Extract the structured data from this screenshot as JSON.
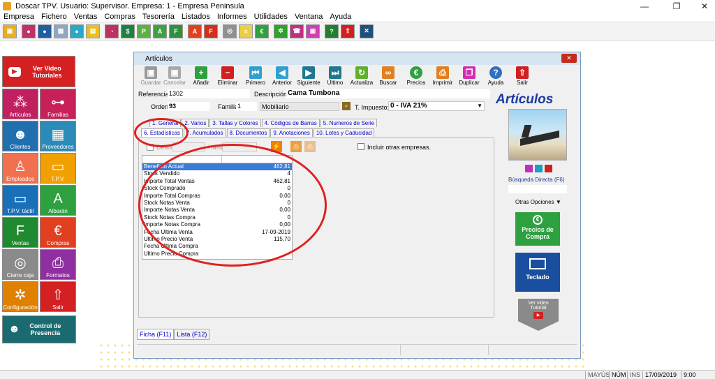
{
  "window_title": "Doscar TPV. Usuario: Supervisor. Empresa: 1 - Empresa Peninsula",
  "menu": [
    "Empresa",
    "Fichero",
    "Ventas",
    "Compras",
    "Tesorería",
    "Listados",
    "Informes",
    "Utilidades",
    "Ventana",
    "Ayuda"
  ],
  "toolbar_icons": [
    "company-icon",
    "users-icon",
    "contacts-icon",
    "calculator-icon",
    "worker-icon",
    "stack-icon",
    "chart-icon",
    "price-icon",
    "p-icon",
    "a-icon",
    "f-icon",
    "a-red-icon",
    "f-red-icon",
    "safe-icon",
    "notes-icon",
    "euro-icon",
    "gears-icon",
    "phone-icon",
    "image-icon",
    "help-icon",
    "exit-icon",
    "tools-icon"
  ],
  "sidebar": {
    "video": "Ver Video Tutoriales",
    "items": [
      "Artículos",
      "Familias",
      "Clientes",
      "Proveedores",
      "Empleados",
      "T.P.V.",
      "T.P.V. táctil",
      "Albarán",
      "Ventas",
      "Compras",
      "Cierre caja",
      "Formatos",
      "Configuración",
      "Salir"
    ],
    "control": "Control de Presencia"
  },
  "articles": {
    "title": "Artículos",
    "buttons": [
      "Guardar",
      "Cancelar",
      "Añadir",
      "Eliminar",
      "Primero",
      "Anterior",
      "Siguiente",
      "Último",
      "Actualiza",
      "Buscar",
      "Precios",
      "Imprimir",
      "Duplicar",
      "Ayuda",
      "Salir"
    ],
    "referencia_label": "Referencia:",
    "referencia": "1302",
    "descripcion_label": "Descripción:",
    "descripcion": "Cama Tumbona",
    "orden_label": "Orden:",
    "orden": "93",
    "familia_label": "Familia:",
    "familia": "1",
    "familia_name": "Mobiliario",
    "impuesto_label": "T. Impuesto:",
    "impuesto": "0 - IVA 21%",
    "tabs_row1": [
      "1. General",
      "2. Varios",
      "3. Tallas y Colores",
      "4. Códigos de Barras",
      "5. Numeros de Serie"
    ],
    "tabs_row2": [
      "6. Estadísticas",
      "7. Acumulados",
      "8. Documentos",
      "9. Anotaciones",
      "10. Lotes y Caducidad"
    ],
    "desde": "Desde",
    "hasta": "Hasta",
    "incluir": "Incluir otras empresas.",
    "stats": [
      {
        "label": "Beneficio Actual",
        "value": "462,81"
      },
      {
        "label": "Stock Vendido",
        "value": "4"
      },
      {
        "label": "Importe Total Ventas",
        "value": "462,81"
      },
      {
        "label": "Stock Comprado",
        "value": "0"
      },
      {
        "label": "Importe Total Compras",
        "value": "0,00"
      },
      {
        "label": "Stock Notas Venta",
        "value": "0"
      },
      {
        "label": "Importe Notas Venta",
        "value": "0,00"
      },
      {
        "label": "Stock Notas Compra",
        "value": "0"
      },
      {
        "label": "Importe Notas Compra",
        "value": "0,00"
      },
      {
        "label": "Fecha Ultima Venta",
        "value": "17-09-2019"
      },
      {
        "label": "Ultimo Precio Venta",
        "value": "115,70"
      },
      {
        "label": "Fecha Ultima Compra",
        "value": ""
      },
      {
        "label": "Ultimo Precio Compra",
        "value": ""
      }
    ],
    "heading": "Artículos",
    "busqueda": "Búsqueda Directa (F6)",
    "otras": "Otras Opciones",
    "precios": "Precios de Compra",
    "teclado": "Teclado",
    "video": "Ver video Tutorial",
    "bottom_tabs": [
      "Ficha (F11)",
      "Lista (F12)"
    ]
  },
  "status": {
    "mayus": "MAYÚS",
    "num": "NÚM",
    "ins": "INS",
    "date": "17/09/2019",
    "time": "9:00"
  }
}
